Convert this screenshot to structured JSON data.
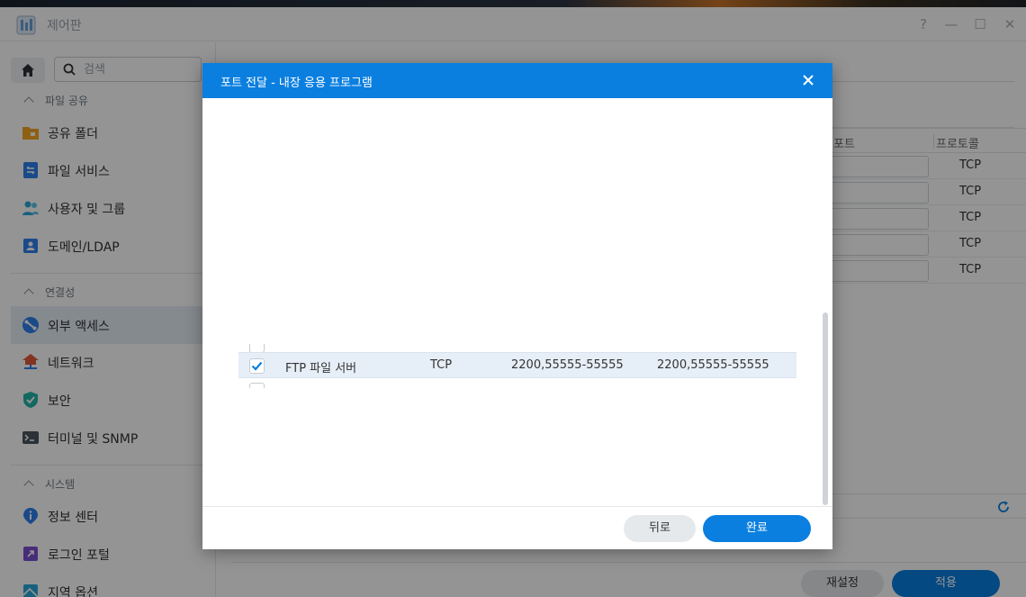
{
  "window": {
    "title": "제어판",
    "controls": {
      "help": "?",
      "minimize": "—",
      "maximize": "☐",
      "close": "✕"
    }
  },
  "sidebar": {
    "search": {
      "placeholder": "검색",
      "value": ""
    },
    "sections": [
      {
        "title": "파일 공유",
        "items": [
          {
            "label": "공유 폴더",
            "icon": "folder-icon",
            "color": "#f5a623"
          },
          {
            "label": "파일 서비스",
            "icon": "file-service-icon",
            "color": "#2f80ed"
          },
          {
            "label": "사용자 및 그룹",
            "icon": "users-icon",
            "color": "#2aa7d8"
          },
          {
            "label": "도메인/LDAP",
            "icon": "domain-icon",
            "color": "#2f80ed"
          }
        ]
      },
      {
        "title": "연결성",
        "items": [
          {
            "label": "외부 액세스",
            "icon": "external-access-icon",
            "color": "#2f80ed",
            "active": true
          },
          {
            "label": "네트워크",
            "icon": "network-icon",
            "color": "#e05a3a"
          },
          {
            "label": "보안",
            "icon": "shield-icon",
            "color": "#21b5a5"
          },
          {
            "label": "터미널 및 SNMP",
            "icon": "terminal-icon",
            "color": "#4a5560"
          }
        ]
      },
      {
        "title": "시스템",
        "items": [
          {
            "label": "정보 센터",
            "icon": "info-icon",
            "color": "#2f80ed"
          },
          {
            "label": "로그인 포털",
            "icon": "login-portal-icon",
            "color": "#7a4fd0"
          },
          {
            "label": "지역 옵션",
            "icon": "region-icon",
            "color": "#2aa7d8"
          }
        ]
      }
    ]
  },
  "background_table": {
    "headers": [
      "포트",
      "프로토콜"
    ],
    "rows": [
      {
        "protocol": "TCP"
      },
      {
        "protocol": "TCP"
      },
      {
        "protocol": "TCP"
      },
      {
        "protocol": "TCP"
      },
      {
        "protocol": "TCP"
      }
    ]
  },
  "background_buttons": {
    "reset": "재설정",
    "apply": "적용"
  },
  "modal": {
    "title": "포트 전달 - 내장 응용 프로그램",
    "rows": [
      {
        "name": "FTP 파일 서버",
        "protocol": "TCP",
        "local_port": "2200,55555-55555",
        "router_port": "2200,55555-55555",
        "checked": true
      }
    ],
    "buttons": {
      "back": "뒤로",
      "done": "완료"
    }
  },
  "colors": {
    "accent": "#0a7fe0",
    "selected_row": "#e6eef7"
  }
}
